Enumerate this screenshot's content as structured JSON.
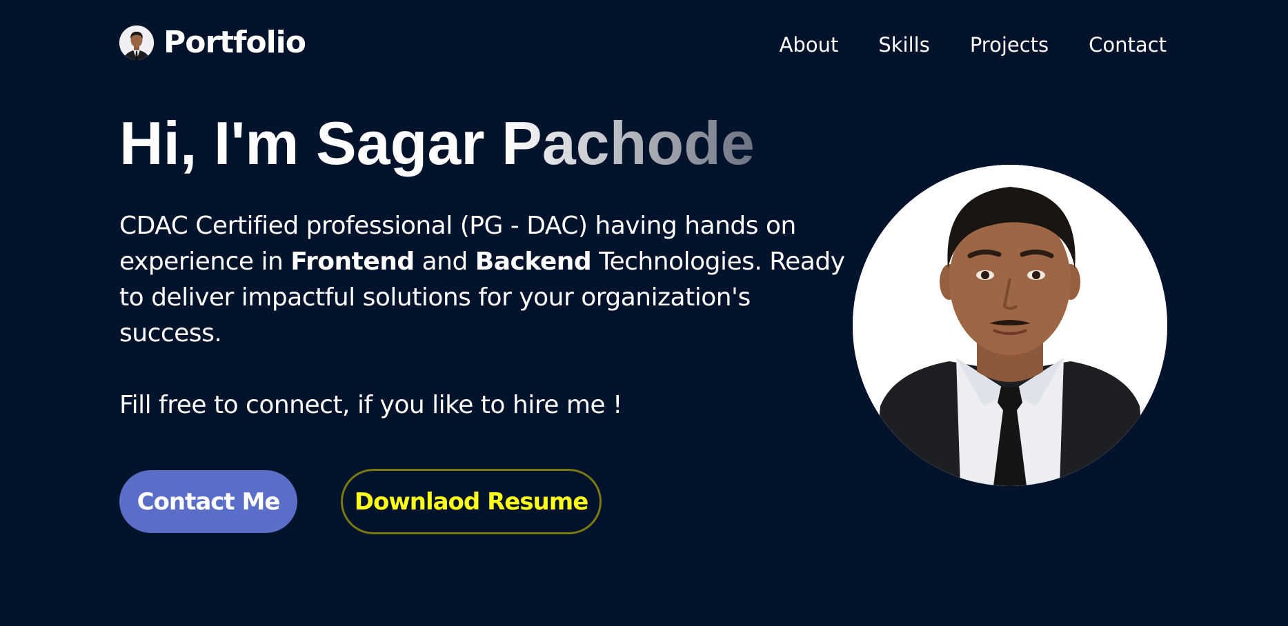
{
  "header": {
    "brand": "Portfolio",
    "nav": [
      {
        "label": "About"
      },
      {
        "label": "Skills"
      },
      {
        "label": "Projects"
      },
      {
        "label": "Contact"
      }
    ]
  },
  "hero": {
    "title": "Hi, I'm Sagar Pachode",
    "desc_part1": "CDAC Certified professional (PG - DAC) having hands on experience in ",
    "desc_bold1": "Frontend",
    "desc_part2": " and ",
    "desc_bold2": "Backend",
    "desc_part3": " Technologies. Ready to deliver impactful solutions for your organization's success.",
    "cta_text": "Fill free to connect, if you like to hire me !",
    "contact_button": "Contact Me",
    "resume_button": "Downlaod Resume"
  },
  "colors": {
    "background": "#04132c",
    "contact_button_bg": "#5b6ec7",
    "resume_text": "#ffff1a",
    "resume_border": "#7b7a11"
  }
}
